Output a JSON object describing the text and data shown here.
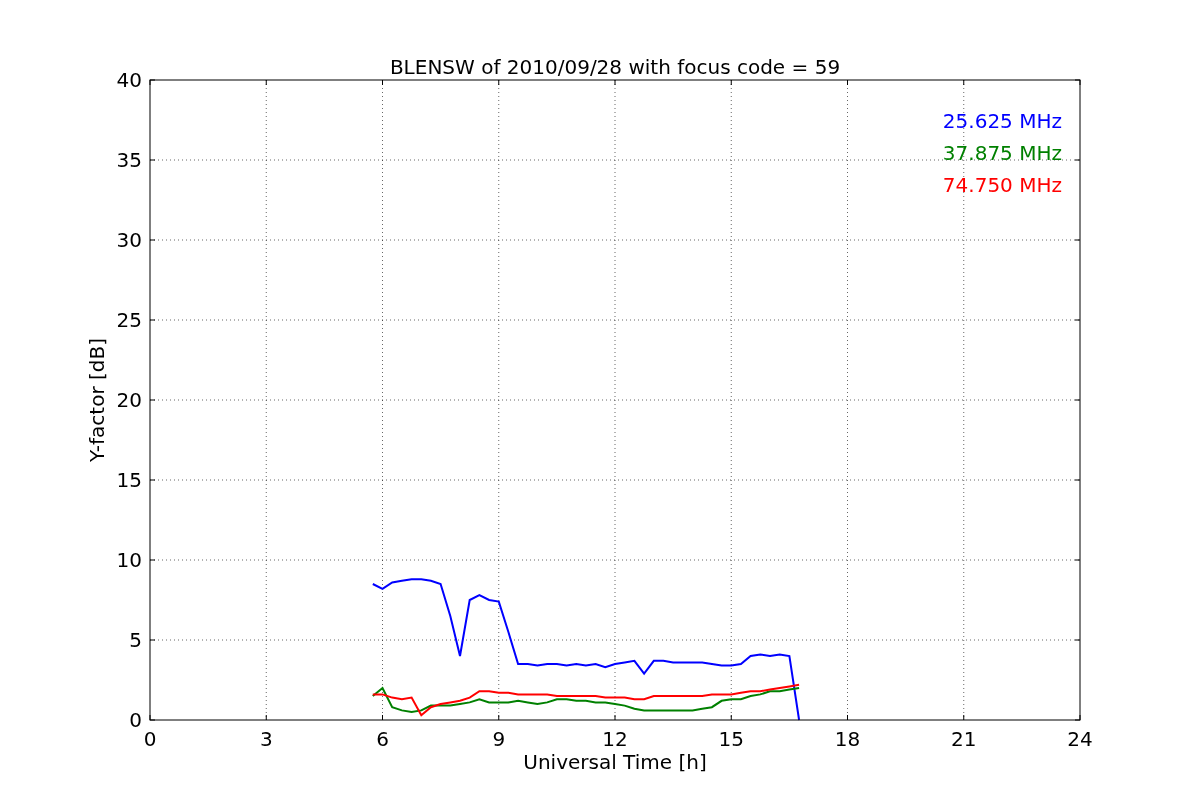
{
  "chart_data": {
    "type": "line",
    "title": "BLENSW of 2010/09/28 with focus code = 59",
    "xlabel": "Universal Time [h]",
    "ylabel": "Y-factor [dB]",
    "x": [
      5.75,
      6,
      6.25,
      6.5,
      6.75,
      7,
      7.25,
      7.5,
      7.75,
      8,
      8.25,
      8.5,
      8.75,
      9,
      9.25,
      9.5,
      9.75,
      10,
      10.25,
      10.5,
      10.75,
      11,
      11.25,
      11.5,
      11.75,
      12,
      12.25,
      12.5,
      12.75,
      13,
      13.25,
      13.5,
      13.75,
      14,
      14.25,
      14.5,
      14.75,
      15,
      15.25,
      15.5,
      15.75,
      16,
      16.25,
      16.5,
      16.75
    ],
    "series": [
      {
        "name": "25.625 MHz",
        "color": "#0000ff",
        "values": [
          8.5,
          8.2,
          8.6,
          8.7,
          8.8,
          8.8,
          8.7,
          8.5,
          6.5,
          4.0,
          7.5,
          7.8,
          7.5,
          7.4,
          5.5,
          3.5,
          3.5,
          3.4,
          3.5,
          3.5,
          3.4,
          3.5,
          3.4,
          3.5,
          3.3,
          3.5,
          3.6,
          3.7,
          2.9,
          3.7,
          3.7,
          3.6,
          3.6,
          3.6,
          3.6,
          3.5,
          3.4,
          3.4,
          3.5,
          4.0,
          4.1,
          4.0,
          4.1,
          4.0,
          0
        ]
      },
      {
        "name": "37.875 MHz",
        "color": "#008000",
        "values": [
          1.5,
          2.0,
          0.8,
          0.6,
          0.5,
          0.6,
          0.9,
          0.9,
          0.9,
          1.0,
          1.1,
          1.3,
          1.1,
          1.1,
          1.1,
          1.2,
          1.1,
          1.0,
          1.1,
          1.3,
          1.3,
          1.2,
          1.2,
          1.1,
          1.1,
          1.0,
          0.9,
          0.7,
          0.6,
          0.6,
          0.6,
          0.6,
          0.6,
          0.6,
          0.7,
          0.8,
          1.2,
          1.3,
          1.3,
          1.5,
          1.6,
          1.8,
          1.8,
          1.9,
          2.0
        ]
      },
      {
        "name": "74.750 MHz",
        "color": "#ff0000",
        "values": [
          1.6,
          1.6,
          1.4,
          1.3,
          1.4,
          0.3,
          0.8,
          1.0,
          1.1,
          1.2,
          1.4,
          1.8,
          1.8,
          1.7,
          1.7,
          1.6,
          1.6,
          1.6,
          1.6,
          1.5,
          1.5,
          1.5,
          1.5,
          1.5,
          1.4,
          1.4,
          1.4,
          1.3,
          1.3,
          1.5,
          1.5,
          1.5,
          1.5,
          1.5,
          1.5,
          1.6,
          1.6,
          1.6,
          1.7,
          1.8,
          1.8,
          1.9,
          2.0,
          2.1,
          2.2
        ]
      }
    ],
    "grid": true,
    "xlim": [
      0,
      24
    ],
    "ylim": [
      0,
      40
    ],
    "xticks": [
      0,
      3,
      6,
      9,
      12,
      15,
      18,
      21,
      24
    ],
    "yticks": [
      0,
      5,
      10,
      15,
      20,
      25,
      30,
      35,
      40
    ]
  }
}
